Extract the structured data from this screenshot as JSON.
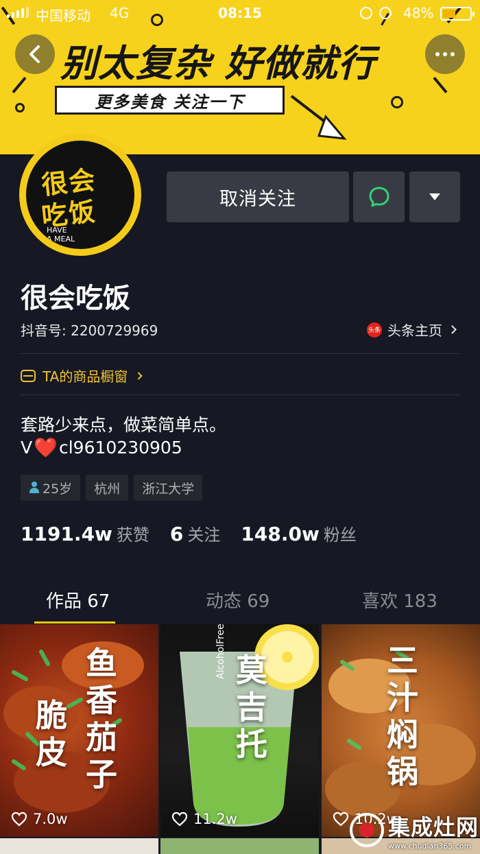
{
  "status_bar": {
    "carrier": "中国移动",
    "network": "4G",
    "time": "08:15",
    "battery_percent": "48%",
    "battery_level": 0.48
  },
  "banner": {
    "headline": "别太复杂  好做就行",
    "subtitle": "更多美食  关注一下"
  },
  "avatar": {
    "logo_line1": "很会",
    "logo_line2": "吃饭",
    "logo_en_line1": "HAVE",
    "logo_en_line2": "A MEAL"
  },
  "actions": {
    "unfollow_label": "取消关注"
  },
  "profile": {
    "nickname": "很会吃饭",
    "douyin_id": "抖音号: 2200729969",
    "toutiao_badge": "头条",
    "toutiao_label": "头条主页",
    "shop_label": "TA的商品橱窗",
    "bio_line1": "套路少来点，做菜简单点。",
    "bio_line2_prefix": "V",
    "bio_line2_heart": "❤️",
    "bio_line2_suffix": "cl9610230905",
    "tags": {
      "age": "25岁",
      "city": "杭州",
      "school": "浙江大学"
    }
  },
  "stats": {
    "likes_num": "1191.4w",
    "likes_label": "获赞",
    "following_num": "6",
    "following_label": "关注",
    "followers_num": "148.0w",
    "followers_label": "粉丝"
  },
  "tabs": {
    "works": "作品 67",
    "moments": "动态 69",
    "favorites": "喜欢 183"
  },
  "videos": [
    {
      "title_col1": "脆皮",
      "title_col2": "鱼香茄子",
      "likes": "7.0w"
    },
    {
      "title": "莫吉托",
      "caption": "AlcoholFree",
      "likes": "11.2w"
    },
    {
      "title": "三汁焖锅",
      "likes": "10.2w"
    }
  ],
  "watermark": {
    "brand": "集成灶网",
    "url": "www.chudian365.com"
  },
  "colors": {
    "background": "#161823",
    "banner_yellow": "#f7d21c",
    "accent": "#f2c80f",
    "button_bg": "#393b44",
    "message_icon": "#2ed573"
  }
}
